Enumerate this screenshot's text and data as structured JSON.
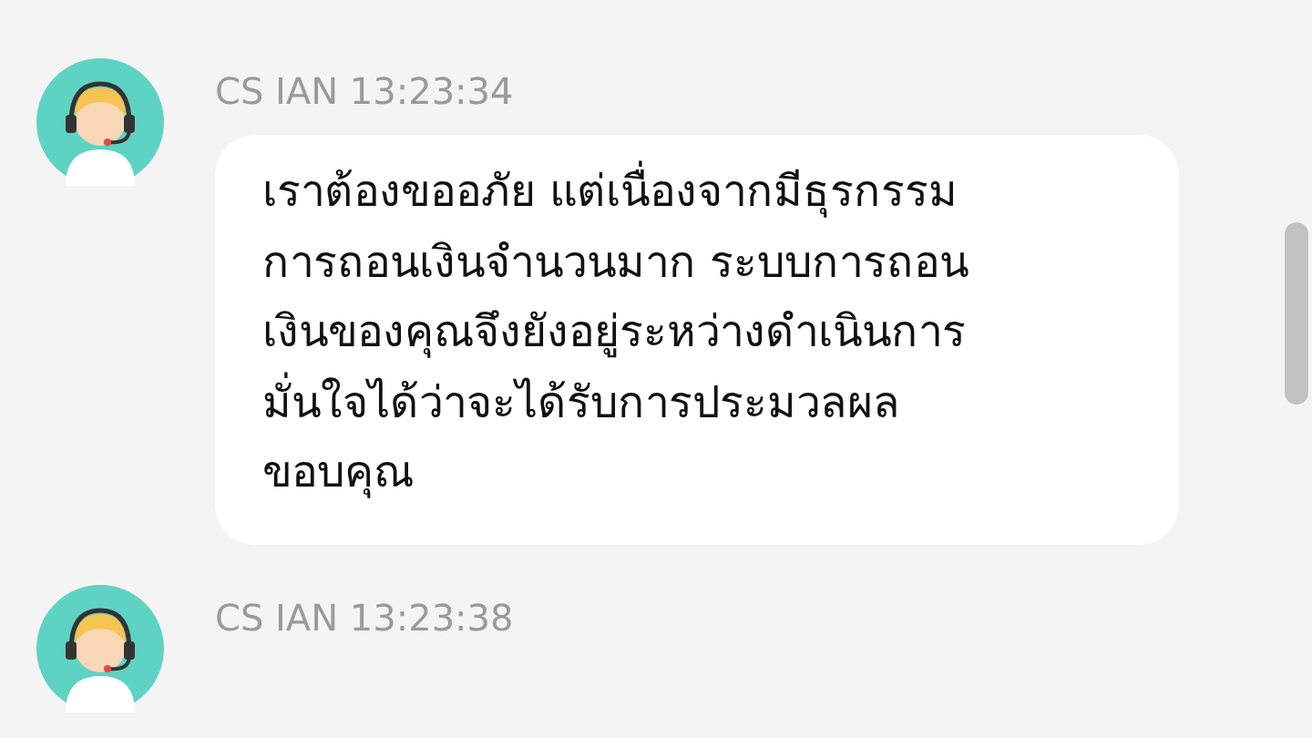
{
  "messages": [
    {
      "sender": "CS IAN",
      "time": "13:23:34",
      "text": "เราต้องขออภัย แต่เนื่องจากมีธุรกรรม\nการถอนเงินจำนวนมาก ระบบการถอน\nเงินของคุณจึงยังอยู่ระหว่างดำเนินการ\nมั่นใจได้ว่าจะได้รับการประมวลผล\nขอบคุณ"
    },
    {
      "sender": "CS IAN",
      "time": "13:23:38"
    }
  ]
}
